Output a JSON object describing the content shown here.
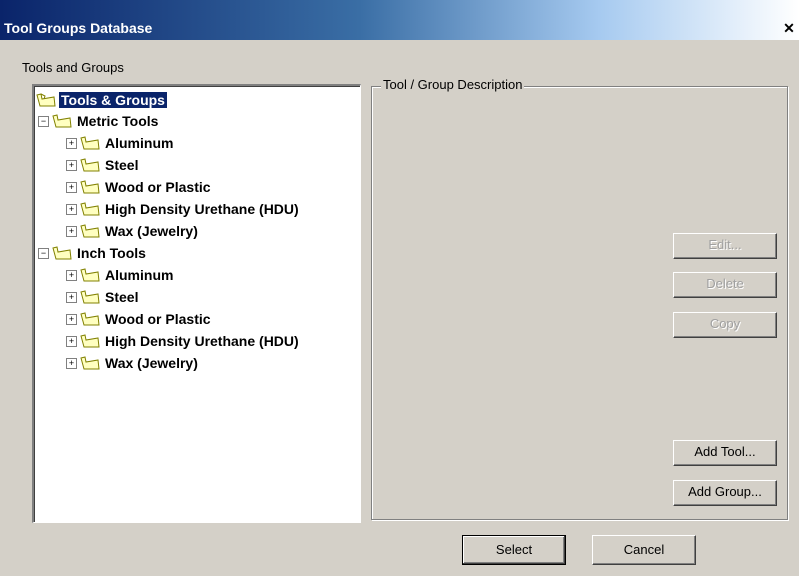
{
  "window": {
    "title": "Tool Groups Database",
    "close_glyph": "✕"
  },
  "tree_section": {
    "label": "Tools and Groups"
  },
  "tree": {
    "root": "Tools & Groups",
    "groups": [
      {
        "label": "Metric Tools",
        "children": [
          "Aluminum",
          "Steel",
          "Wood or Plastic",
          "High Density Urethane (HDU)",
          "Wax (Jewelry)"
        ]
      },
      {
        "label": "Inch Tools",
        "children": [
          "Aluminum",
          "Steel",
          "Wood or Plastic",
          "High Density Urethane (HDU)",
          "Wax (Jewelry)"
        ]
      }
    ]
  },
  "description": {
    "label": "Tool / Group Description"
  },
  "buttons": {
    "edit": "Edit...",
    "delete": "Delete",
    "copy": "Copy",
    "add_tool": "Add Tool...",
    "add_group": "Add Group...",
    "select": "Select",
    "cancel": "Cancel"
  },
  "icons": {
    "folder": "folder-icon",
    "expand": "expand-icon",
    "collapse": "collapse-icon"
  }
}
